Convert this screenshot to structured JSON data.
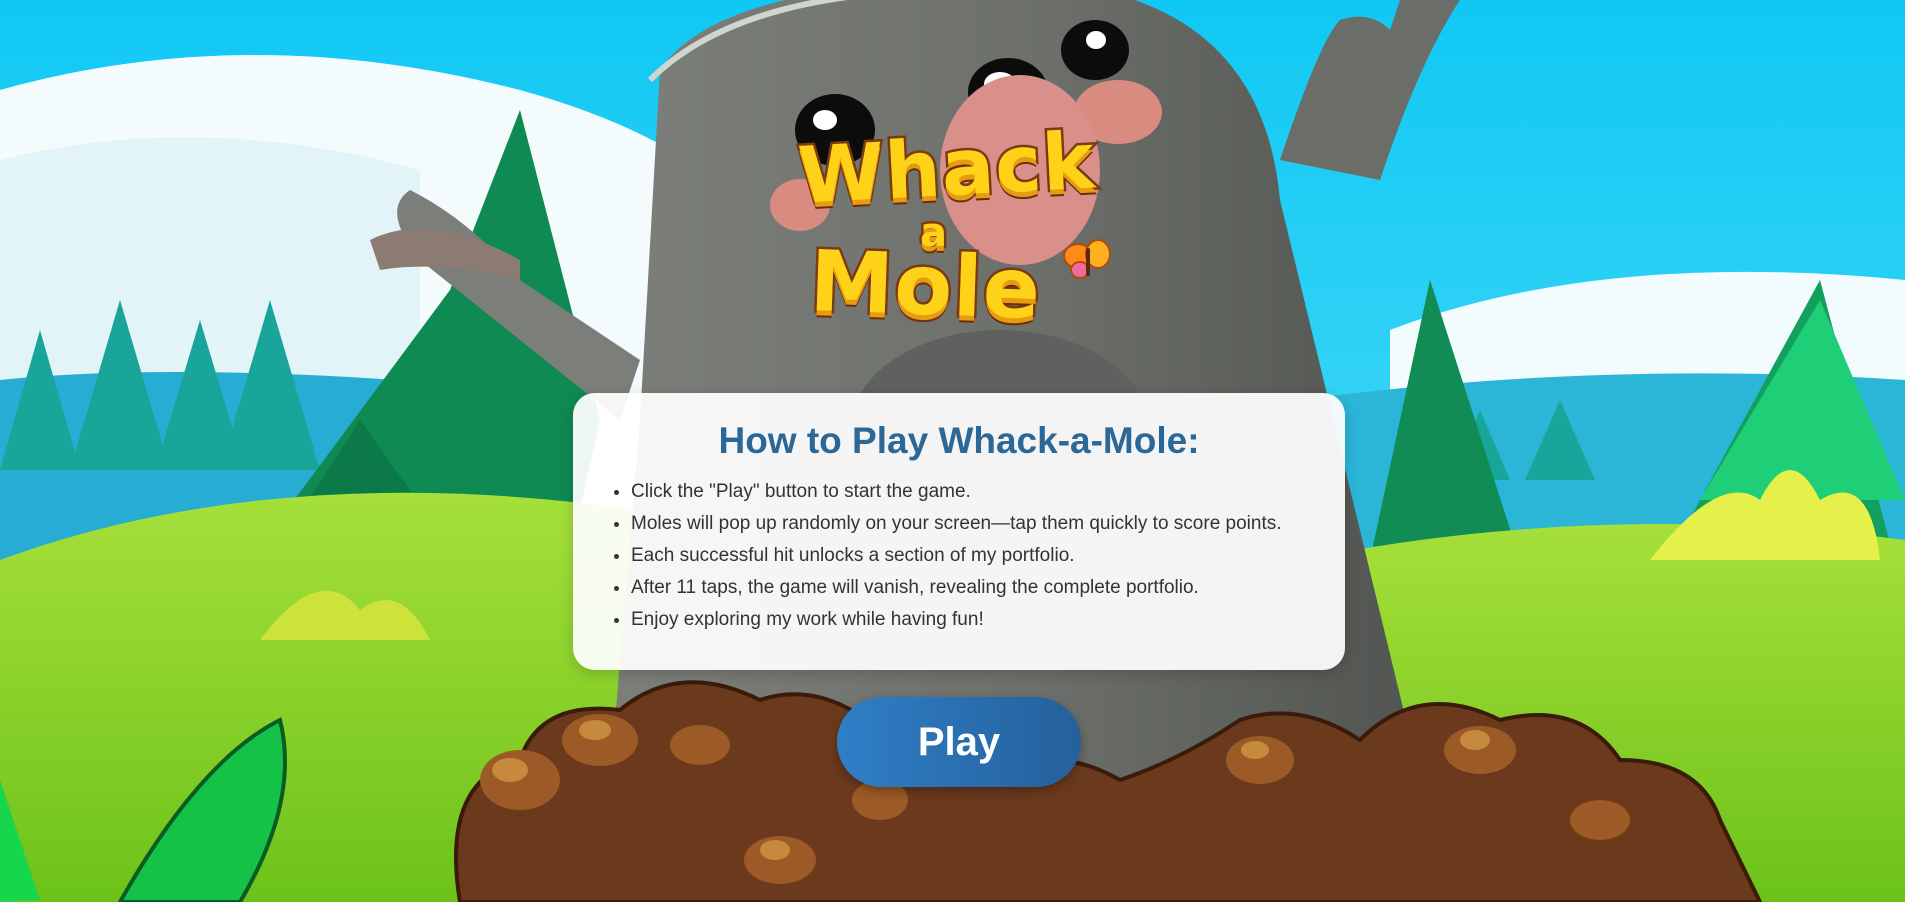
{
  "logo": {
    "line1": "Whack",
    "line2": "a",
    "line3": "Mole"
  },
  "instructions": {
    "title": "How to Play Whack-a-Mole:",
    "items": [
      "Click the \"Play\" button to start the game.",
      "Moles will pop up randomly on your screen—tap them quickly to score points.",
      "Each successful hit unlocks a section of my portfolio.",
      "After 11 taps, the game will vanish, revealing the complete portfolio.",
      "Enjoy exploring my work while having fun!"
    ]
  },
  "play_button": {
    "label": "Play"
  },
  "colors": {
    "title": "#2b6797",
    "button": "#2f7fc7",
    "sky": "#1ad3f5",
    "logo": "#ffd21a"
  }
}
